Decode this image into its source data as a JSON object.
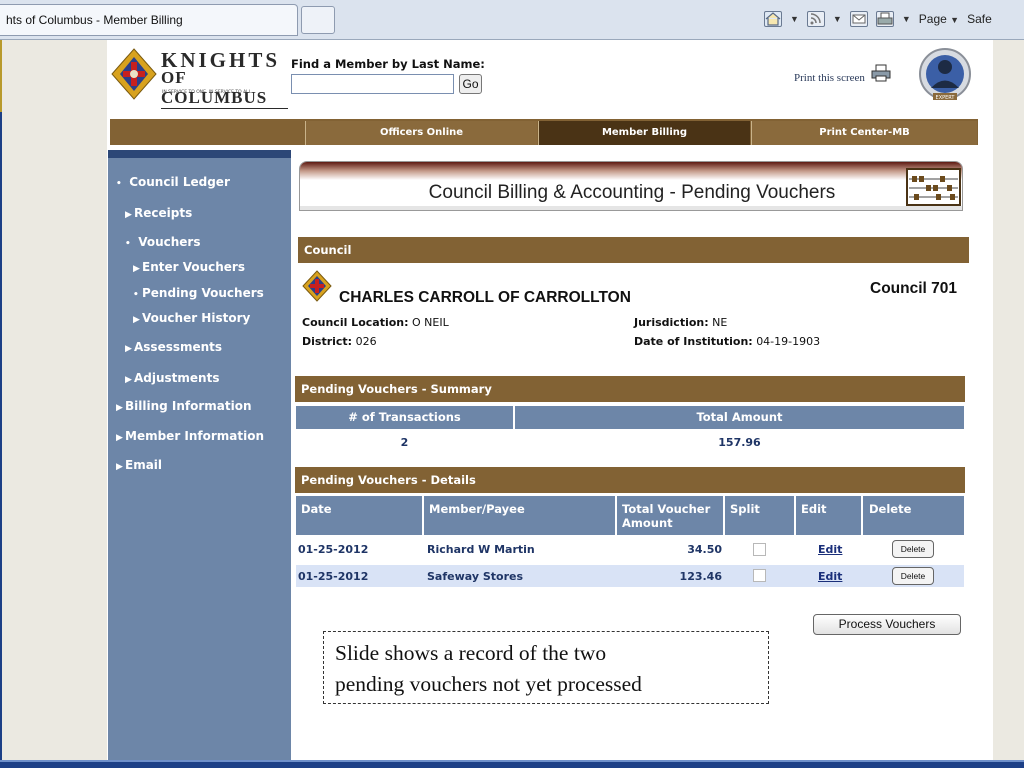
{
  "browser": {
    "tab_title": "hts of Columbus - Member Billing",
    "page_menu": "Page",
    "safety_menu": "Safe"
  },
  "header": {
    "logo_word1": "KNIGHTS",
    "logo_word2": "OF COLUMBUS",
    "logo_tagline": "IN SERVICE TO ONE. IN SERVICE TO ALL.",
    "find_label": "Find a Member by Last Name:",
    "find_value": "",
    "go_label": "Go",
    "print_label": "Print this screen",
    "expert_badge": "EXPERT"
  },
  "nav": {
    "tabs": [
      {
        "label": "Officers Online"
      },
      {
        "label": "Member Billing"
      },
      {
        "label": "Print Center-MB"
      }
    ]
  },
  "sidebar": {
    "items": [
      {
        "label": "Council Ledger"
      },
      {
        "label": "Receipts"
      },
      {
        "label": "Vouchers"
      },
      {
        "label": "Enter Vouchers"
      },
      {
        "label": "Pending Vouchers"
      },
      {
        "label": "Voucher History"
      },
      {
        "label": "Assessments"
      },
      {
        "label": "Adjustments"
      },
      {
        "label": "Billing Information"
      },
      {
        "label": "Member Information"
      },
      {
        "label": "Email"
      }
    ]
  },
  "banner": {
    "title": "Council Billing & Accounting - Pending Vouchers"
  },
  "council": {
    "section_label": "Council",
    "name": "CHARLES CARROLL OF CARROLLTON",
    "number": "Council 701",
    "location_label": "Council Location:",
    "location": "O NEIL",
    "district_label": "District:",
    "district": "026",
    "jurisdiction_label": "Jurisdiction:",
    "jurisdiction": "NE",
    "institution_label": "Date of Institution:",
    "institution": "04-19-1903"
  },
  "summary": {
    "section_label": "Pending Vouchers - Summary",
    "col_transactions": "# of Transactions",
    "col_total": "Total Amount",
    "transactions": "2",
    "total": "157.96"
  },
  "details": {
    "section_label": "Pending Vouchers - Details",
    "columns": {
      "date": "Date",
      "payee": "Member/Payee",
      "amount": "Total Voucher Amount",
      "split": "Split",
      "edit": "Edit",
      "delete": "Delete"
    },
    "rows": [
      {
        "date": "01-25-2012",
        "payee": "Richard  W  Martin",
        "amount": "34.50",
        "split": false,
        "edit": "Edit",
        "delete": "Delete"
      },
      {
        "date": "01-25-2012",
        "payee": "Safeway Stores",
        "amount": "123.46",
        "split": false,
        "edit": "Edit",
        "delete": "Delete"
      }
    ],
    "process_label": "Process Vouchers"
  },
  "note": {
    "line1": "Slide shows a record of the  two",
    "line2": "pending vouchers not yet processed"
  },
  "colors": {
    "brown_bar": "#826234",
    "active_tab": "#4a3315",
    "sidebar": "#6d86a8",
    "table_header": "#6d86a8",
    "alt_row": "#d9e3f6"
  }
}
